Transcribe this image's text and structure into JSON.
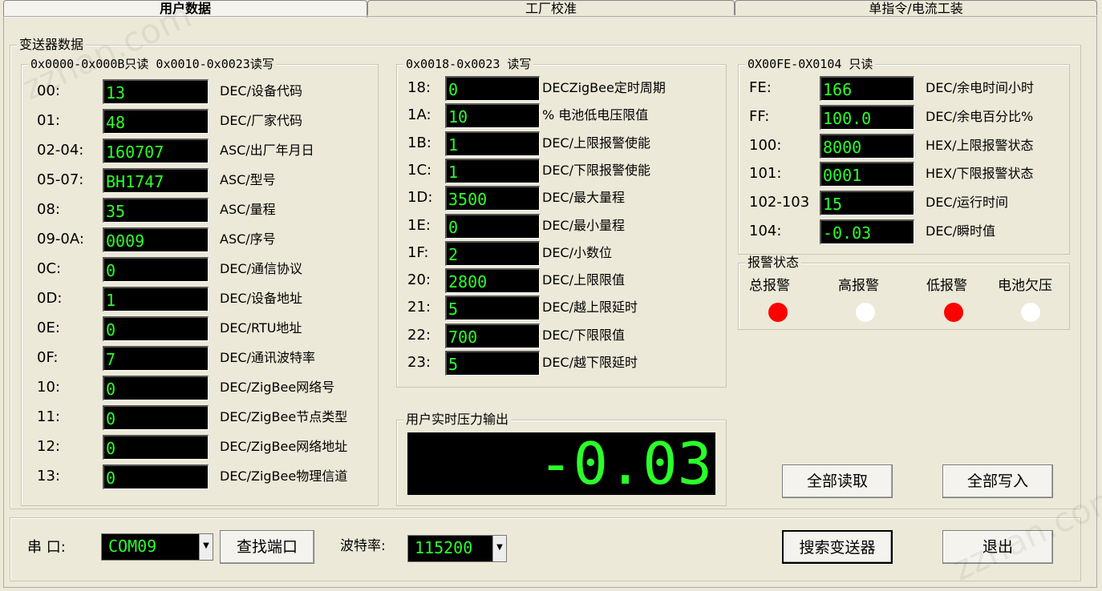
{
  "tabs": [
    {
      "label": "用户数据"
    },
    {
      "label": "工厂校准"
    },
    {
      "label": "单指令/电流工装"
    }
  ],
  "transmitter_group": {
    "title": "变送器数据"
  },
  "reg_group1": {
    "title": "0x0000-0x000B只读  0x0010-0x0023读写",
    "rows": [
      {
        "addr": "00:",
        "value": "13",
        "desc": "DEC/设备代码"
      },
      {
        "addr": "01:",
        "value": "48",
        "desc": "DEC/厂家代码"
      },
      {
        "addr": "02-04:",
        "value": "160707",
        "desc": "ASC/出厂年月日"
      },
      {
        "addr": "05-07:",
        "value": "BH1747",
        "desc": "ASC/型号"
      },
      {
        "addr": "08:",
        "value": "35",
        "desc": "ASC/量程"
      },
      {
        "addr": "09-0A:",
        "value": "0009",
        "desc": "ASC/序号"
      },
      {
        "addr": "0C:",
        "value": "0",
        "desc": "DEC/通信协议"
      },
      {
        "addr": "0D:",
        "value": "1",
        "desc": "DEC/设备地址"
      },
      {
        "addr": "0E:",
        "value": "0",
        "desc": "DEC/RTU地址"
      },
      {
        "addr": "0F:",
        "value": "7",
        "desc": "DEC/通讯波特率"
      },
      {
        "addr": "10:",
        "value": "0",
        "desc": "DEC/ZigBee网络号"
      },
      {
        "addr": "11:",
        "value": "0",
        "desc": "DEC/ZigBee节点类型"
      },
      {
        "addr": "12:",
        "value": "0",
        "desc": "DEC/ZigBee网络地址"
      },
      {
        "addr": "13:",
        "value": "0",
        "desc": "DEC/ZigBee物理信道"
      }
    ]
  },
  "reg_group2": {
    "title": "0x0018-0x0023 读写",
    "rows": [
      {
        "addr": "18:",
        "value": "0",
        "desc": "DECZigBee定时周期"
      },
      {
        "addr": "1A:",
        "value": "10",
        "desc": "% 电池低电压限值"
      },
      {
        "addr": "1B:",
        "value": "1",
        "desc": "DEC/上限报警使能"
      },
      {
        "addr": "1C:",
        "value": "1",
        "desc": "DEC/下限报警使能"
      },
      {
        "addr": "1D:",
        "value": "3500",
        "desc": "DEC/最大量程"
      },
      {
        "addr": "1E:",
        "value": "0",
        "desc": "DEC/最小量程"
      },
      {
        "addr": "1F:",
        "value": "2",
        "desc": "DEC/小数位"
      },
      {
        "addr": "20:",
        "value": "2800",
        "desc": "DEC/上限限值"
      },
      {
        "addr": "21:",
        "value": "5",
        "desc": "DEC/越上限延时"
      },
      {
        "addr": "22:",
        "value": "700",
        "desc": "DEC/下限限值"
      },
      {
        "addr": "23:",
        "value": "5",
        "desc": "DEC/越下限延时"
      }
    ]
  },
  "reg_group3": {
    "title": "0X00FE-0X0104 只读",
    "rows": [
      {
        "addr": "FE:",
        "value": "166",
        "desc": "DEC/余电时间小时"
      },
      {
        "addr": "FF:",
        "value": "100.0",
        "desc": "DEC/余电百分比%"
      },
      {
        "addr": "100:",
        "value": "8000",
        "desc": "HEX/上限报警状态"
      },
      {
        "addr": "101:",
        "value": "0001",
        "desc": "HEX/下限报警状态"
      },
      {
        "addr": "102-103",
        "value": "15",
        "desc": "DEC/运行时间"
      },
      {
        "addr": "104:",
        "value": "-0.03",
        "desc": "DEC/瞬时值"
      }
    ]
  },
  "alarm": {
    "title": "报警状态",
    "items": [
      {
        "label": "总报警",
        "color": "#ff0000"
      },
      {
        "label": "高报警",
        "color": "#ffffff"
      },
      {
        "label": "低报警",
        "color": "#ff0000"
      },
      {
        "label": "电池欠压",
        "color": "#ffffff"
      }
    ]
  },
  "realtime": {
    "title": "用户实时压力输出",
    "value": "-0.03"
  },
  "buttons": {
    "read_all": "全部读取",
    "write_all": "全部写入",
    "find_port": "查找端口",
    "search": "搜索变送器",
    "exit": "退出"
  },
  "serial": {
    "port_label": "串  口:",
    "port_value": "COM09",
    "baud_label": "波特率:",
    "baud_value": "115200"
  },
  "colors": {
    "led_text": "#2bff2b",
    "led_bg": "#000000",
    "window_bg": "#ece9d8"
  }
}
